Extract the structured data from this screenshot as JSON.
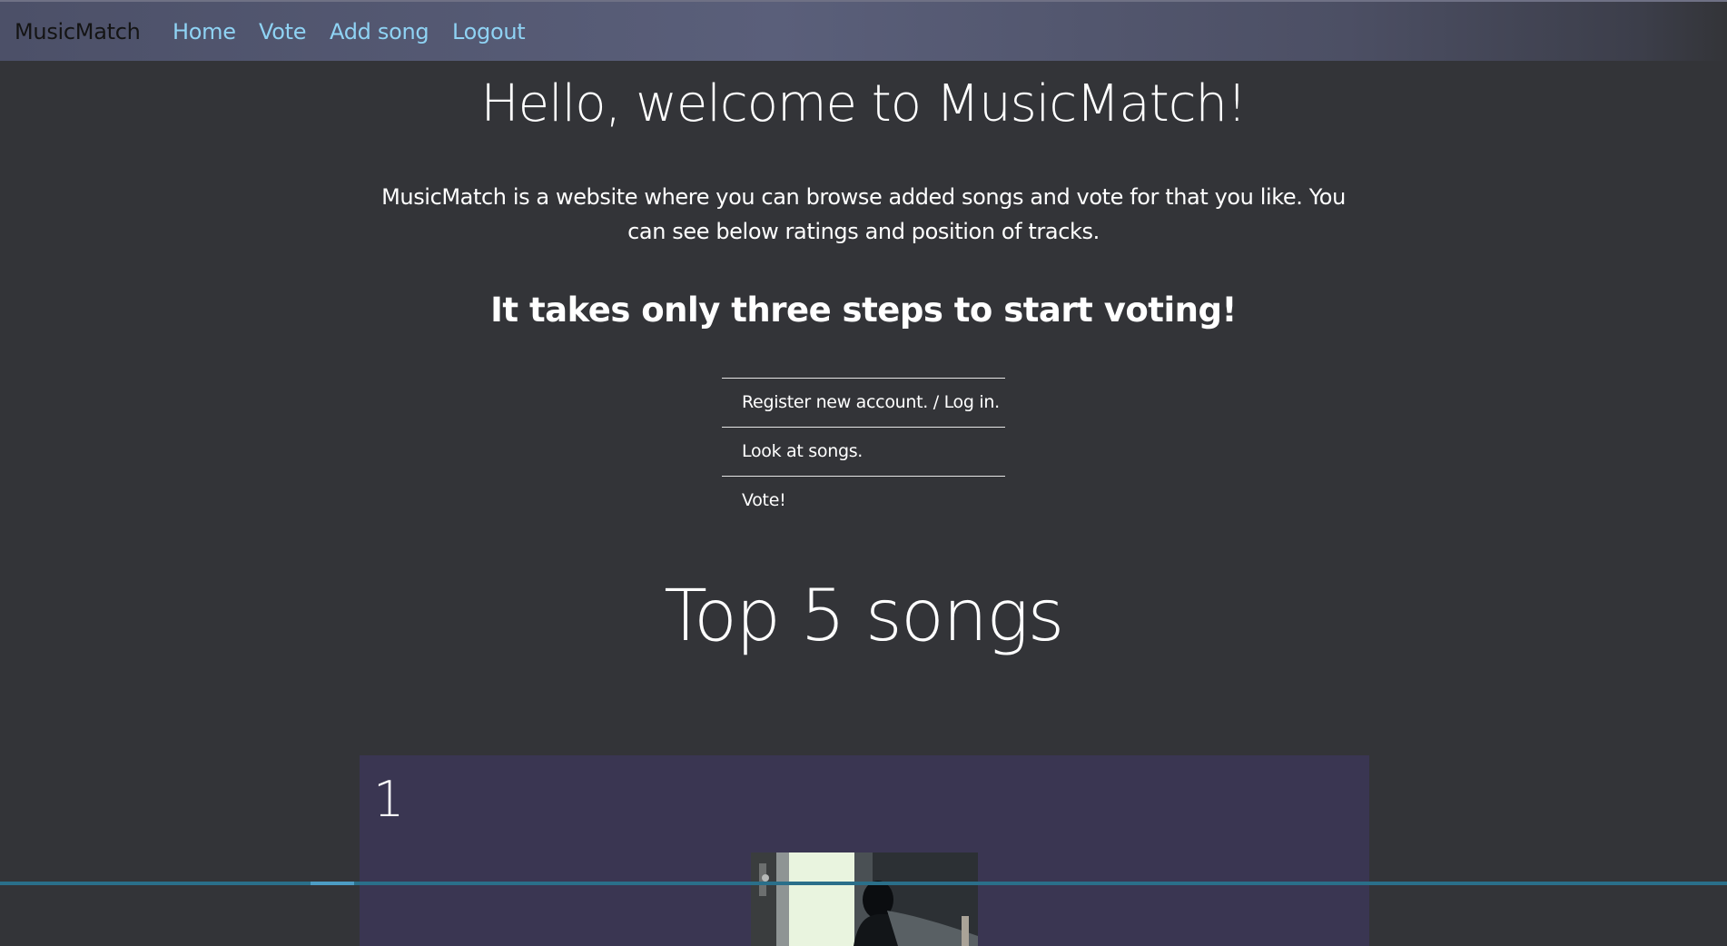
{
  "navbar": {
    "brand": "MusicMatch",
    "links": [
      {
        "label": "Home"
      },
      {
        "label": "Vote"
      },
      {
        "label": "Add song"
      },
      {
        "label": "Logout"
      }
    ],
    "brand_color": "#141414",
    "link_color": "#8fd3f4"
  },
  "main": {
    "hero_title": "Hello, welcome to MusicMatch!",
    "intro": "MusicMatch is a website where you can browse added songs and vote for that you like. You can see below ratings and position of tracks.",
    "steps_title": "It takes only three steps to start voting!",
    "steps": [
      {
        "label": "Register new account. / Log in."
      },
      {
        "label": "Look at songs."
      },
      {
        "label": "Vote!"
      }
    ],
    "top_songs_title": "Top 5 songs",
    "songs": [
      {
        "rank": "1",
        "image_icon": "album-cover-image"
      }
    ]
  },
  "colors": {
    "page_background": "#333438",
    "card_background": "#3a3652",
    "text": "#ffffff"
  }
}
